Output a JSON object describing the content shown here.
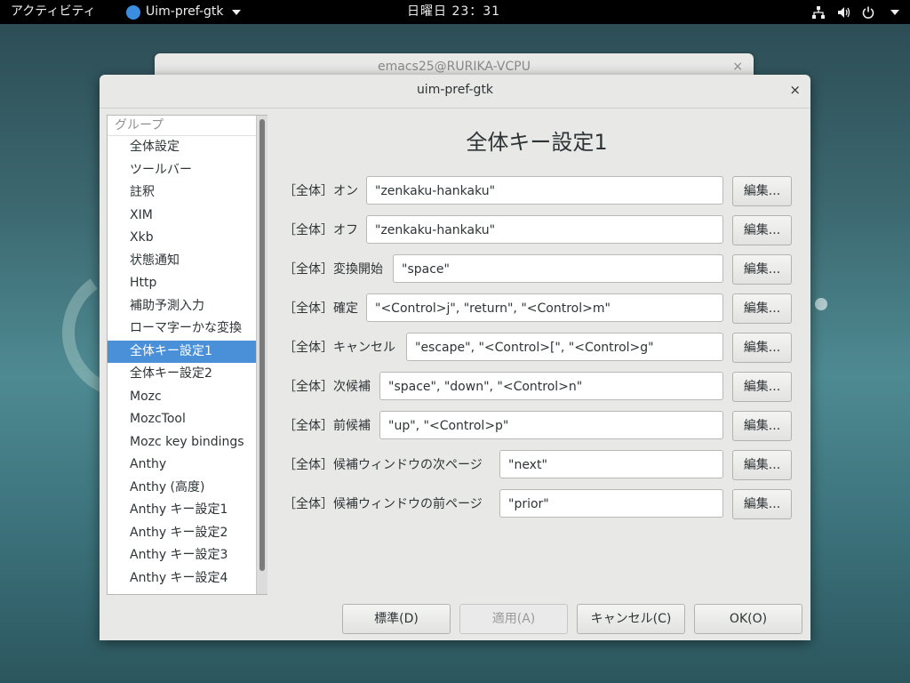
{
  "topbar": {
    "activities": "アクティビティ",
    "app_name": "Uim-pref-gtk",
    "clock": "日曜日 23：31"
  },
  "background_window": {
    "title": "emacs25@RURIKA-VCPU",
    "close": "×"
  },
  "dialog": {
    "title": "uim-pref-gtk",
    "close": "×",
    "sidebar_header": "グループ",
    "groups": [
      "全体設定",
      "ツールバー",
      "註釈",
      "XIM",
      "Xkb",
      "状態通知",
      "Http",
      "補助予測入力",
      "ローマ字ーかな変換",
      "全体キー設定1",
      "全体キー設定2",
      "Mozc",
      "MozcTool",
      "Mozc key bindings",
      "Anthy",
      "Anthy (高度)",
      "Anthy キー設定1",
      "Anthy キー設定2",
      "Anthy キー設定3",
      "Anthy キー設定4"
    ],
    "selected_index": 9,
    "panel_title": "全体キー設定1",
    "edit_label": "編集...",
    "rows": [
      {
        "label": "［全体］オン",
        "value": "\"zenkaku-hankaku\""
      },
      {
        "label": "［全体］オフ",
        "value": "\"zenkaku-hankaku\""
      },
      {
        "label": "［全体］変換開始",
        "value": "\"space\""
      },
      {
        "label": "［全体］確定",
        "value": "\"<Control>j\", \"return\", \"<Control>m\""
      },
      {
        "label": "［全体］キャンセル",
        "value": "\"escape\", \"<Control>[\", \"<Control>g\""
      },
      {
        "label": "［全体］次候補",
        "value": "\"space\", \"down\", \"<Control>n\""
      },
      {
        "label": "［全体］前候補",
        "value": "\"up\", \"<Control>p\""
      },
      {
        "label": "［全体］候補ウィンドウの次ページ",
        "value": "\"next\""
      },
      {
        "label": "［全体］候補ウィンドウの前ページ",
        "value": "\"prior\""
      }
    ],
    "buttons": {
      "default": "標準(D)",
      "apply": "適用(A)",
      "cancel": "キャンセル(C)",
      "ok": "OK(O)"
    }
  },
  "colors": {
    "selection": "#4a90d9",
    "topbar": "#000000",
    "dialog_bg": "#e8e8e7"
  }
}
